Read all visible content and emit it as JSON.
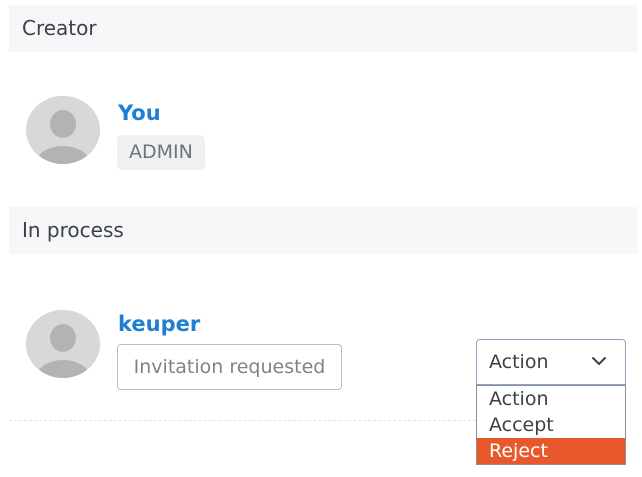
{
  "sections": {
    "creator": {
      "title": "Creator"
    },
    "in_process": {
      "title": "In process"
    }
  },
  "creator": {
    "name": "You",
    "role": "ADMIN",
    "avatar_icon": "user-silhouette-icon"
  },
  "pending": {
    "name": "keuper",
    "status": "Invitation requested",
    "avatar_icon": "user-silhouette-icon",
    "action_select": {
      "selected_label": "Action",
      "chevron_icon": "chevron-down-icon",
      "options": [
        {
          "label": "Action",
          "highlighted": false
        },
        {
          "label": "Accept",
          "highlighted": false
        },
        {
          "label": "Reject",
          "highlighted": true
        }
      ]
    }
  },
  "colors": {
    "link_blue": "#1f7fd0",
    "highlight_orange": "#e8582a",
    "header_bg": "#f6f7f9",
    "badge_bg": "#eff0f2",
    "avatar_gray": "#d8d8d8"
  }
}
